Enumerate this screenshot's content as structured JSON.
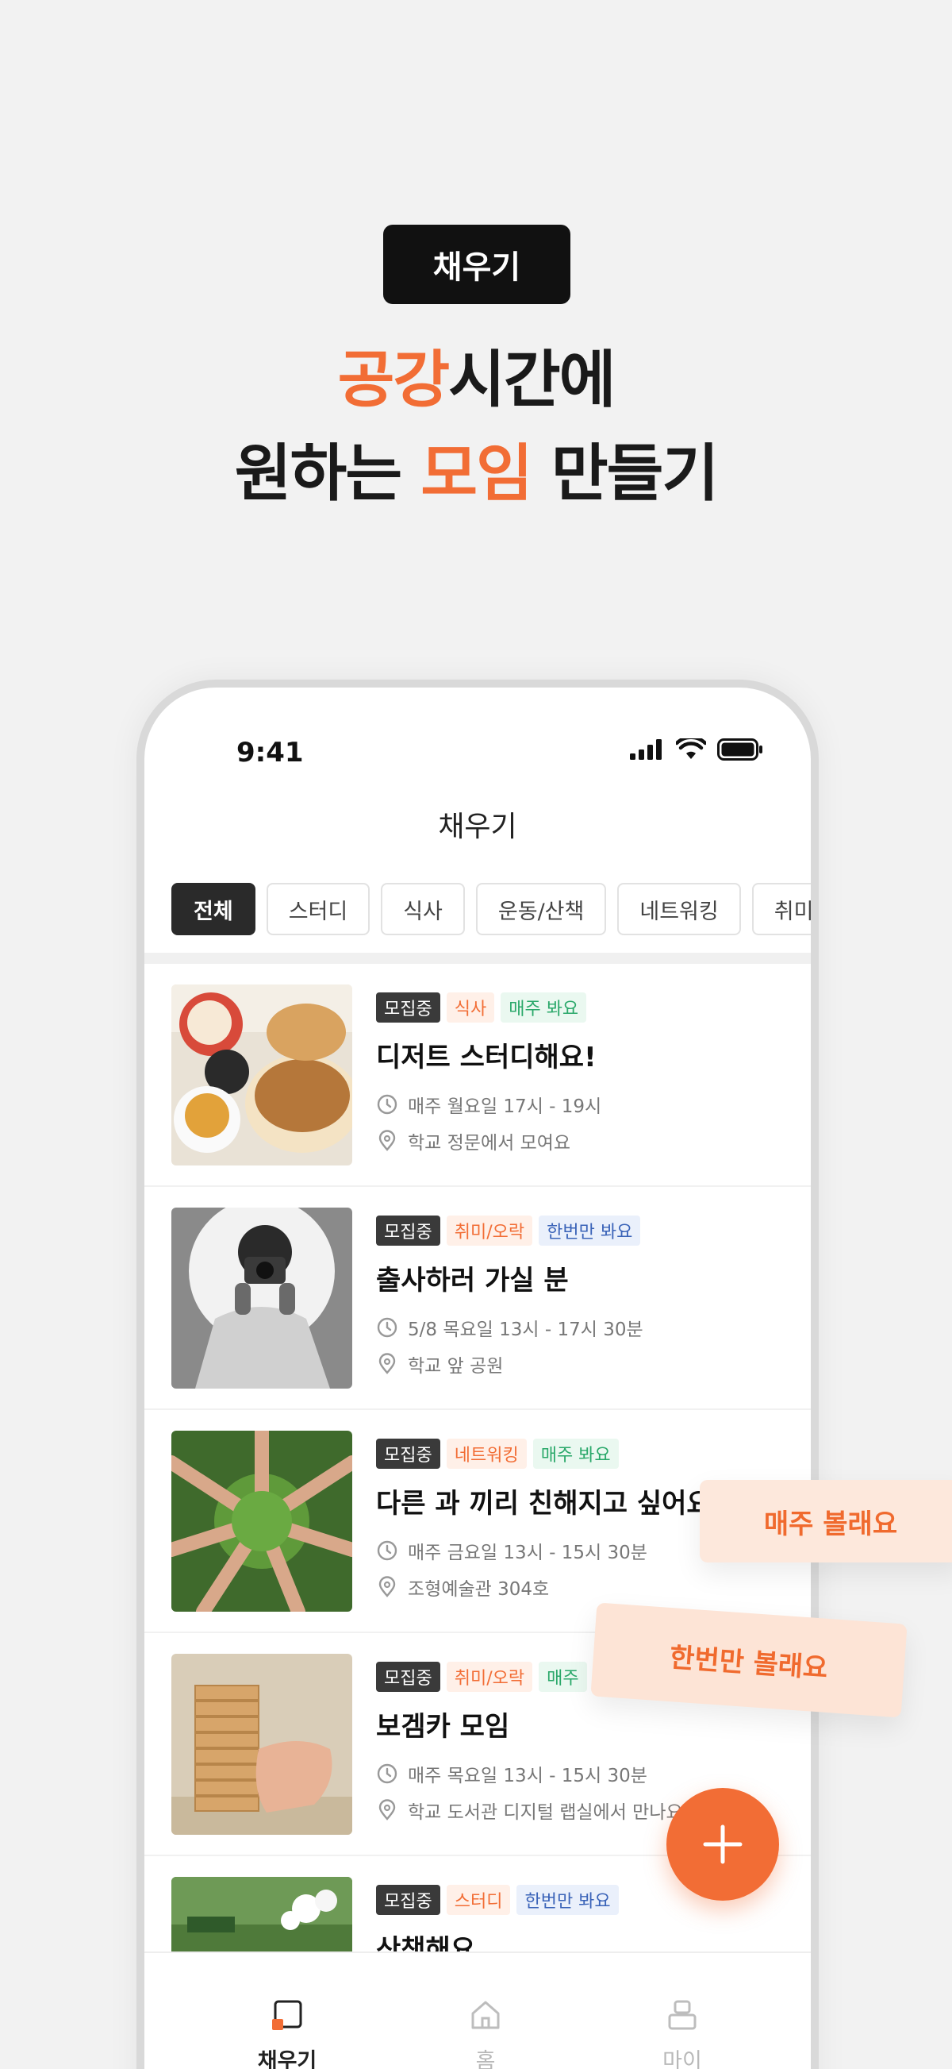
{
  "hero": {
    "badge": "채우기",
    "line1_accent": "공강",
    "line1_rest": "시간에",
    "line2_pre": "원하는 ",
    "line2_accent": "모임",
    "line2_post": " 만들기"
  },
  "status_bar": {
    "time": "9:41"
  },
  "app": {
    "title": "채우기"
  },
  "tabs": [
    "전체",
    "스터디",
    "식사",
    "운동/산책",
    "네트워킹",
    "취미/오락"
  ],
  "active_tab": "전체",
  "list": [
    {
      "status": "모집중",
      "category": "식사",
      "frequency": "매주 봐요",
      "title": "디저트 스터디해요!",
      "time": "매주 월요일 17시 - 19시",
      "place": "학교 정문에서 모여요"
    },
    {
      "status": "모집중",
      "category": "취미/오락",
      "frequency": "한번만 봐요",
      "title": "출사하러 가실 분",
      "time": "5/8 목요일 13시 - 17시 30분",
      "place": "학교 앞 공원"
    },
    {
      "status": "모집중",
      "category": "네트워킹",
      "frequency": "매주 봐요",
      "title": "다른 과 끼리 친해지고 싶어요",
      "time": "매주 금요일 13시 - 15시 30분",
      "place": "조형예술관 304호"
    },
    {
      "status": "모집중",
      "category": "취미/오락",
      "frequency": "매주",
      "title": "보겜카 모임",
      "time": "매주 목요일 13시 - 15시 30분",
      "place": "학교 도서관 디지털 랩실에서 만나요"
    },
    {
      "status": "모집중",
      "category": "스터디",
      "frequency": "한번만 봐요",
      "title": "산책해요",
      "time": "",
      "place": ""
    }
  ],
  "floating": {
    "weekly": "매주 볼래요",
    "once": "한번만 볼래요"
  },
  "bottom_nav": {
    "fill": "채우기",
    "home": "홈",
    "my": "마이"
  },
  "colors": {
    "accent": "#f26d35",
    "dark": "#111111",
    "weekly_green": "#2aa86a",
    "once_blue": "#3a63b8"
  }
}
